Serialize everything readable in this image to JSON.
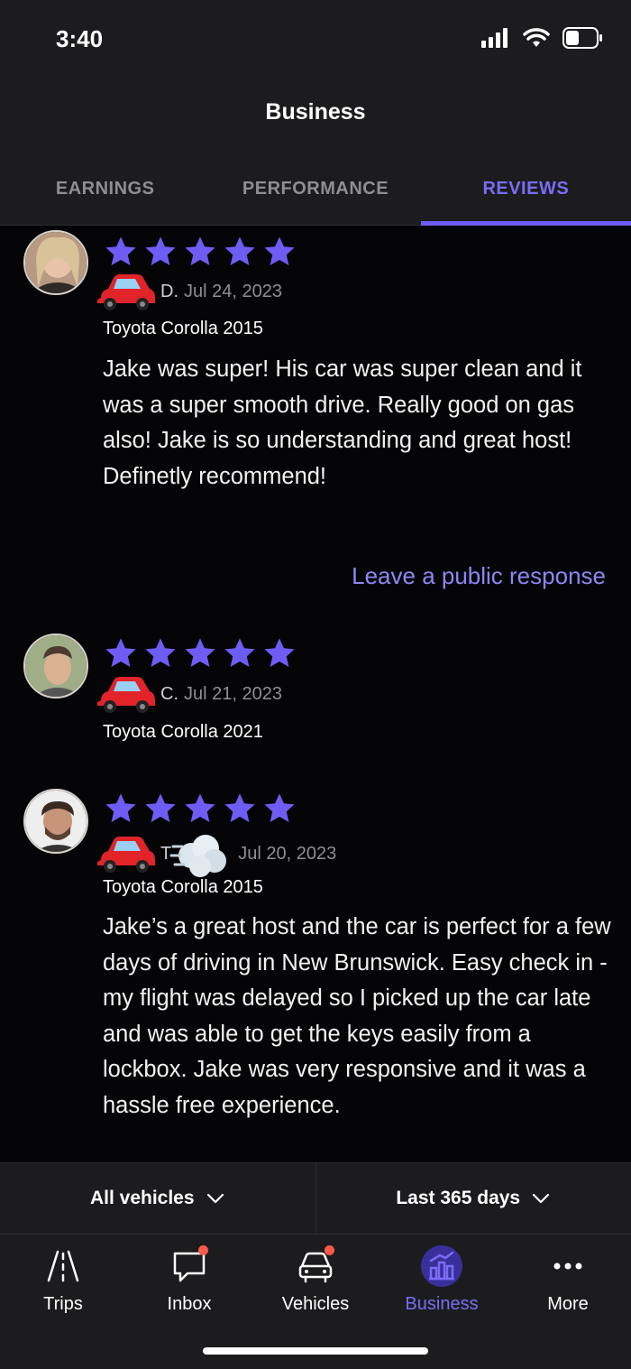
{
  "status_bar": {
    "time": "3:40"
  },
  "header": {
    "title": "Business"
  },
  "tabs": [
    {
      "label": "EARNINGS",
      "active": false
    },
    {
      "label": "PERFORMANCE",
      "active": false
    },
    {
      "label": "REVIEWS",
      "active": true
    }
  ],
  "reviews": [
    {
      "rating": 5,
      "reviewer": "D.",
      "date": "Jul 24, 2023",
      "vehicle": "Toyota Corolla 2015",
      "text": "Jake was super! His car was super clean and it was a super smooth drive. Really good on gas also! Jake is so understanding and great host! Definetly recommend!",
      "action": "Leave a public response"
    },
    {
      "rating": 5,
      "reviewer": "C.",
      "date": "Jul 21, 2023",
      "vehicle": "Toyota Corolla 2021",
      "text": ""
    },
    {
      "rating": 5,
      "reviewer": "T",
      "date": "Jul 20, 2023",
      "vehicle": "Toyota Corolla 2015",
      "text": "Jake’s a great host and the car is perfect for a few days of driving in New Brunswick. Easy check in - my flight was delayed so I picked up the car late and was able to get the keys easily from a lockbox. Jake was very responsive and it was a hassle free experience."
    }
  ],
  "filters": {
    "vehicles": "All vehicles",
    "period": "Last 365 days"
  },
  "nav": [
    {
      "label": "Trips",
      "icon": "road-icon",
      "badge": false
    },
    {
      "label": "Inbox",
      "icon": "chat-bubble-icon",
      "badge": true
    },
    {
      "label": "Vehicles",
      "icon": "car-icon",
      "badge": true
    },
    {
      "label": "Business",
      "icon": "chart-icon",
      "badge": false,
      "active": true
    },
    {
      "label": "More",
      "icon": "ellipsis-icon",
      "badge": false
    }
  ],
  "colors": {
    "accent": "#6f5cf5",
    "background": "#050507",
    "header": "#1c1c1e"
  }
}
